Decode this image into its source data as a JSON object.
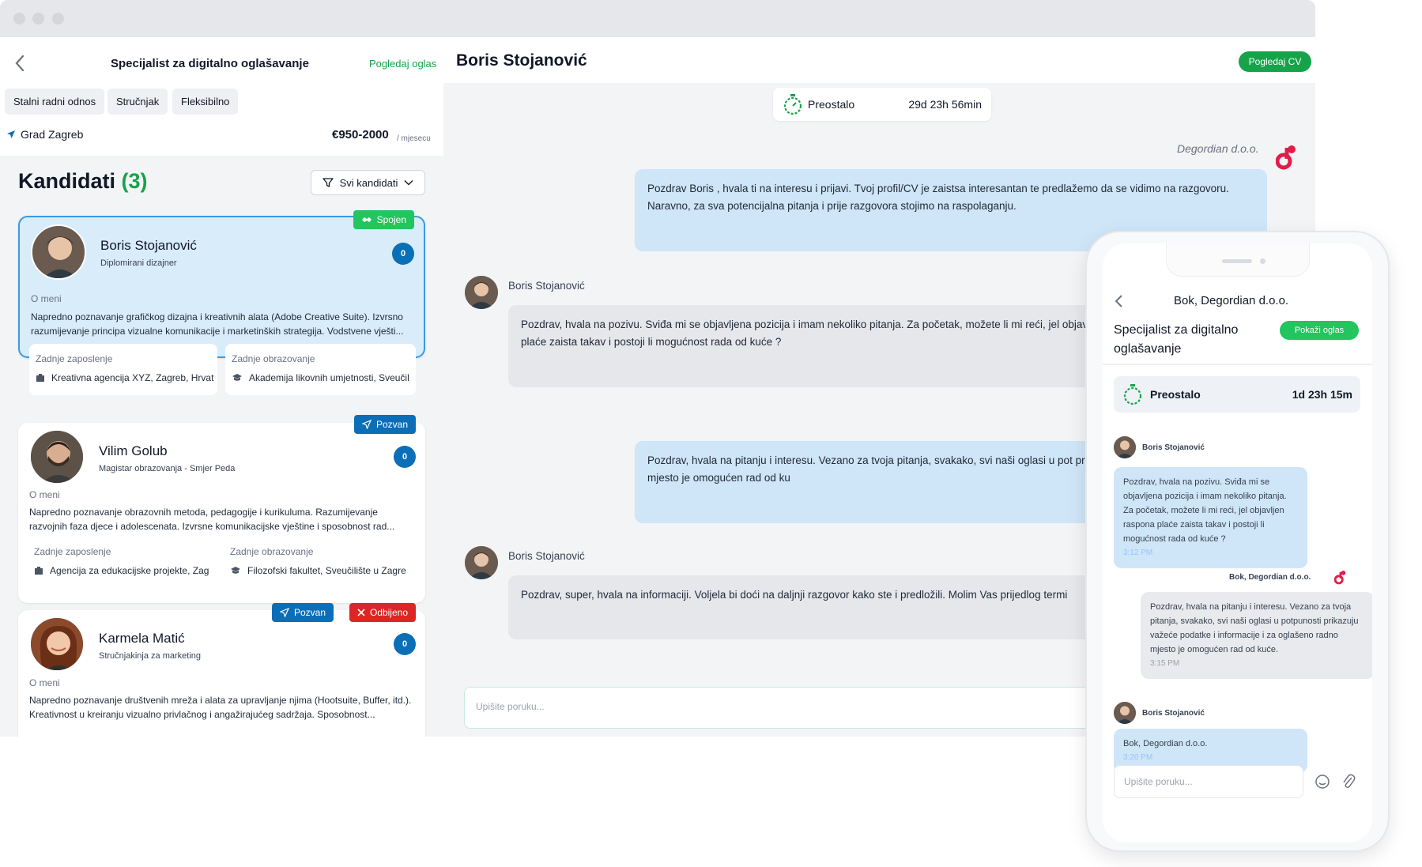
{
  "job": {
    "title": "Specijalist za digitalno oglašavanje",
    "view_ad": "Pogledaj oglas",
    "tags": [
      "Stalni radni odnos",
      "Stručnjak",
      "Fleksibilno"
    ],
    "location": "Grad Zagreb",
    "salary": "€950-2000",
    "salary_unit": "/ mjesecu"
  },
  "candidates": {
    "title": "Kandidati",
    "count": "(3)",
    "filter_label": "Svi kandidati",
    "items": [
      {
        "name": "Boris Stojanović",
        "role": "Diplomirani dizajner",
        "badge": "0",
        "status": "Spojen",
        "about_label": "O meni",
        "about": "Napredno poznavanje grafičkog dizajna i kreativnih alata (Adobe Creative Suite). Izvrsno razumijevanje principa vizualne komunikacije i marketinških strategija. Vodstvene vješti...",
        "last_job_label": "Zadnje zaposlenje",
        "last_job": "Kreativna agencija XYZ, Zagreb, Hrvat",
        "last_edu_label": "Zadnje obrazovanje",
        "last_edu": "Akademija likovnih umjetnosti, Sveučil"
      },
      {
        "name": "Vilim Golub",
        "role": "Magistar obrazovanja - Smjer Peda",
        "badge": "0",
        "status": "Pozvan",
        "about_label": "O meni",
        "about": "Napredno poznavanje obrazovnih metoda, pedagogije i kurikuluma. Razumijevanje razvojnih faza djece i adolescenata. Izvrsne komunikacijske vještine i sposobnost rad...",
        "last_job_label": "Zadnje zaposlenje",
        "last_job": "Agencija za edukacijske projekte, Zag",
        "last_edu_label": "Zadnje obrazovanje",
        "last_edu": "Filozofski fakultet, Sveučilište u Zagre"
      },
      {
        "name": "Karmela Matić",
        "role": "Stručnjakinja za marketing",
        "badge": "0",
        "status": "Pozvan",
        "status2": "Odbijeno",
        "about_label": "O meni",
        "about": "Napredno poznavanje društvenih mreža i alata za upravljanje njima (Hootsuite, Buffer, itd.). Kreativnost u kreiranju vizualno privlačnog i angažirajućeg sadržaja. Sposobnost..."
      }
    ]
  },
  "chat": {
    "name": "Boris Stojanović",
    "cv_button": "Pogledaj CV",
    "timer_label": "Preostalo",
    "timer_value": "29d 23h 56min",
    "company": "Degordian d.o.o.",
    "messages": [
      {
        "from": "company",
        "text": "Pozdrav Boris , hvala ti na interesu i prijavi. Tvoj profil/CV je zaistsa interesantan te predlažemo da se vidimo na razgovoru. Naravno, za sva potencijalna pitanja i prije razgovora stojimo na raspolaganju."
      },
      {
        "from": "Boris Stojanović",
        "text": "Pozdrav, hvala na pozivu. Sviđa mi se objavljena pozicija i imam nekoliko pitanja. Za početak, možete li mi reći, jel objavljen raspona plaće zaista takav i postoji li mogućnost rada od kuće ?"
      },
      {
        "from": "company",
        "text": "Pozdrav, hvala na pitanju i interesu. Vezano za tvoja pitanja, svakako, svi naši oglasi u pot prikazuju važeće podatke i informacije i za oglašeno radno mjesto je omogućen rad od ku"
      },
      {
        "from": "Boris Stojanović",
        "text": "Pozdrav, super, hvala na informaciji. Voljela bi doći na daljnji razgovor kako ste i predložili. Molim Vas prijedlog termi"
      }
    ],
    "input_placeholder": "Upišite poruku..."
  },
  "phone": {
    "title": "Bok, Degordian d.o.o.",
    "job": "Specijalist za digitalno oglašavanje",
    "button": "Pokaži oglas",
    "timer_label": "Preostalo",
    "timer_value": "1d 23h 15m",
    "messages": [
      {
        "sender": "Boris Stojanović",
        "text": "Pozdrav, hvala na pozivu. Sviđa mi se objavljena pozicija i imam nekoliko pitanja. Za početak, možete li mi reći, jel objavljen raspona plaće zaista takav i postoji li mogućnost rada od kuće ?",
        "time": "3:12 PM"
      },
      {
        "sender": "Bok, Degordian d.o.o.",
        "text": "Pozdrav, hvala na pitanju i interesu. Vezano za tvoja pitanja, svakako, svi naši oglasi u potpunosti prikazuju važeće podatke i informacije i za oglašeno radno mjesto je omogućen rad od kuće.",
        "time": "3:15 PM"
      },
      {
        "sender": "Boris Stojanović",
        "text": "Bok, Degordian d.o.o.",
        "time": "3:20 PM"
      }
    ],
    "input_placeholder": "Upišite poruku..."
  },
  "colors": {
    "green": "#16a34a",
    "blue": "#0b6fb8",
    "red": "#dc2626",
    "accent_blue": "#3b9ae1"
  }
}
